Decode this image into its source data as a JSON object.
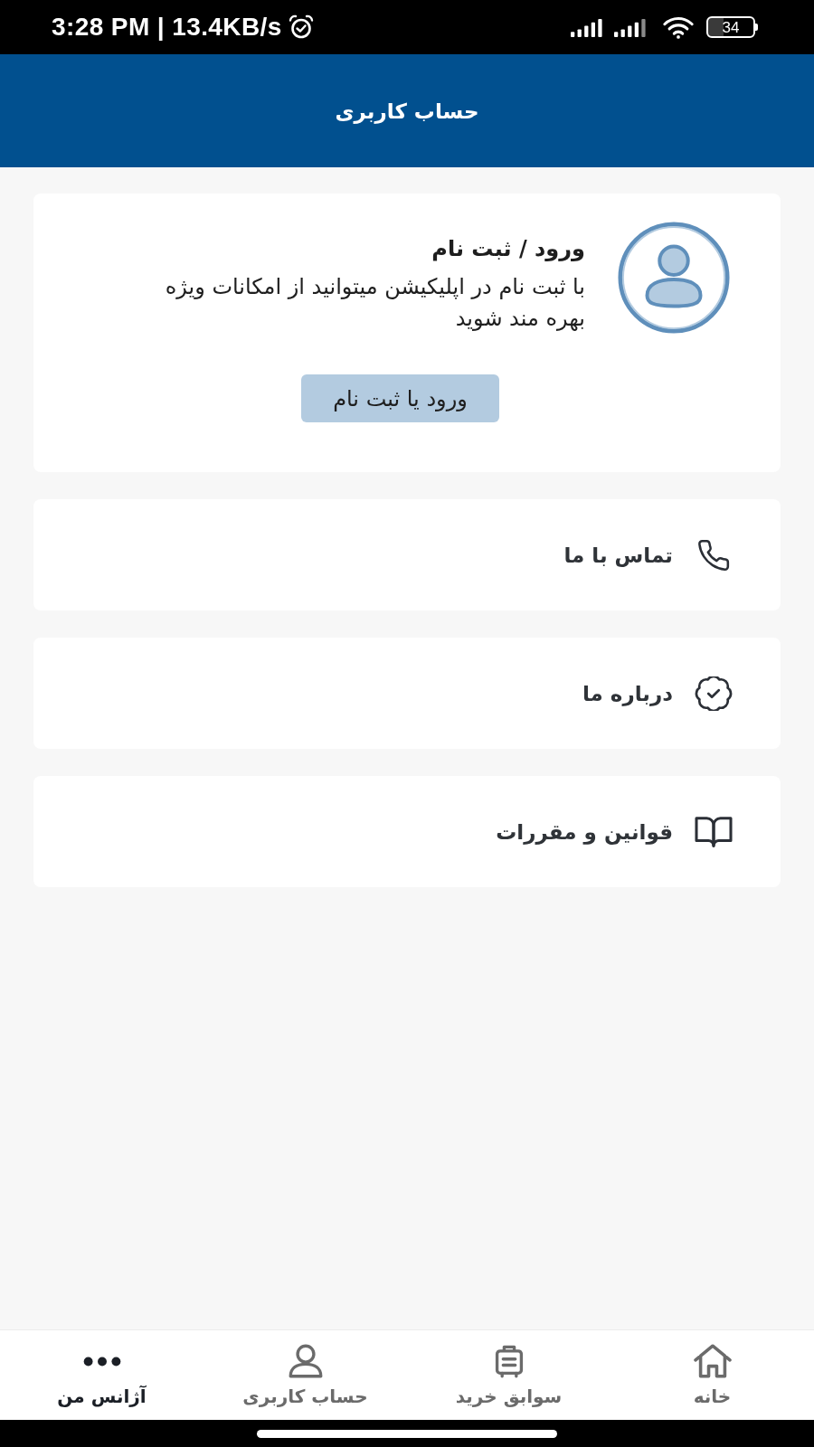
{
  "status_bar": {
    "time": "3:28 PM | 13.4KB/s",
    "battery": "34"
  },
  "header": {
    "title": "حساب کاربری"
  },
  "login_card": {
    "title": "ورود / ثبت نام",
    "description": "با ثبت نام در اپلیکیشن میتوانید از امکانات ویژه بهره مند شوید",
    "button": "ورود یا ثبت نام"
  },
  "menu": [
    {
      "label": "تماس با ما"
    },
    {
      "label": "درباره ما"
    },
    {
      "label": "قوانین و مقررات"
    }
  ],
  "bottom_nav": {
    "items": [
      {
        "label": "خانه",
        "selected": false
      },
      {
        "label": "سوابق خرید",
        "selected": false
      },
      {
        "label": "حساب کاربری",
        "selected": false
      },
      {
        "label": "آژانس من",
        "selected": true
      }
    ]
  }
}
